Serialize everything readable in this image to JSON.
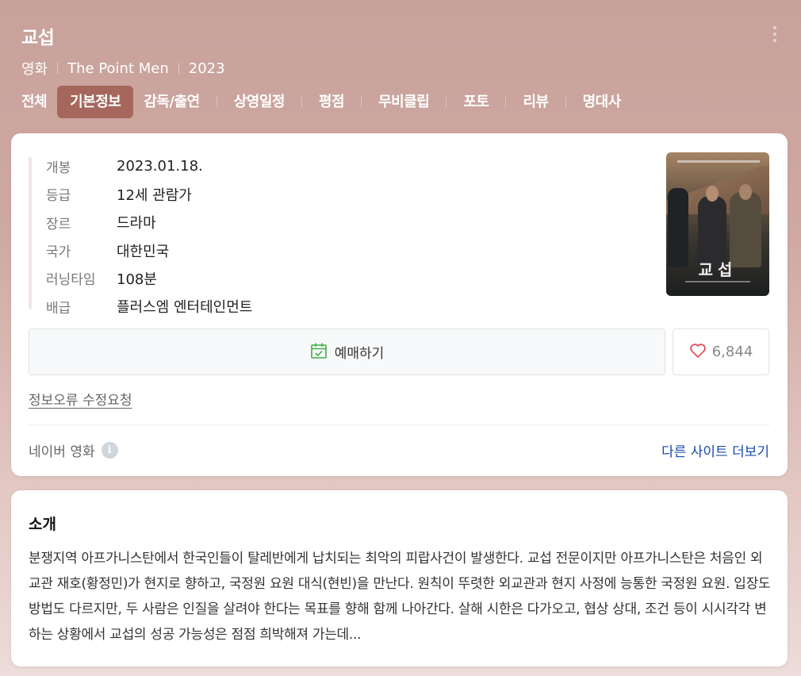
{
  "header": {
    "title": "교섭",
    "meta": [
      "영화",
      "The Point Men",
      "2023"
    ],
    "tabs": [
      {
        "label": "전체",
        "active": false
      },
      {
        "label": "기본정보",
        "active": true
      },
      {
        "label": "감독/출연",
        "active": false
      },
      {
        "label": "상영일정",
        "active": false
      },
      {
        "label": "평점",
        "active": false
      },
      {
        "label": "무비클립",
        "active": false
      },
      {
        "label": "포토",
        "active": false
      },
      {
        "label": "리뷰",
        "active": false
      },
      {
        "label": "명대사",
        "active": false
      }
    ]
  },
  "info": {
    "rows": [
      {
        "label": "개봉",
        "value": "2023.01.18."
      },
      {
        "label": "등급",
        "value": "12세 관람가"
      },
      {
        "label": "장르",
        "value": "드라마"
      },
      {
        "label": "국가",
        "value": "대한민국"
      },
      {
        "label": "러닝타임",
        "value": "108분"
      },
      {
        "label": "배급",
        "value": "플러스엠 엔터테인먼트"
      }
    ],
    "poster_title": "교섭",
    "reserve_label": "예매하기",
    "like_count": "6,844",
    "report_label": "정보오류 수정요청",
    "source_label": "네이버 영화",
    "info_icon_text": "i",
    "more_sites_label": "다른 사이트 더보기"
  },
  "intro": {
    "title": "소개",
    "text": "분쟁지역 아프가니스탄에서 한국인들이 탈레반에게 납치되는 최악의 피랍사건이 발생한다. 교섭 전문이지만 아프가니스탄은 처음인 외교관 재호(황정민)가 현지로 향하고, 국정원 요원 대식(현빈)을 만난다. 원칙이 뚜렷한 외교관과 현지 사정에 능통한 국정원 요원. 입장도 방법도 다르지만, 두 사람은 인질을 살려야 한다는 목표를 향해 함께 나아간다. 살해 시한은 다가오고, 협상 상대, 조건 등이 시시각각 변하는 상황에서 교섭의 성공 가능성은 점점 희박해져 가는데..."
  },
  "colors": {
    "header_bg": "#c7a19a",
    "active_tab": "#a5675c",
    "link_blue": "#1a4aa8",
    "reserve_icon": "#3cb043",
    "heart": "#e04a5a"
  },
  "icons": {
    "more": "more-vertical-icon",
    "reserve": "calendar-check-icon",
    "like": "heart-icon",
    "info": "info-icon"
  }
}
